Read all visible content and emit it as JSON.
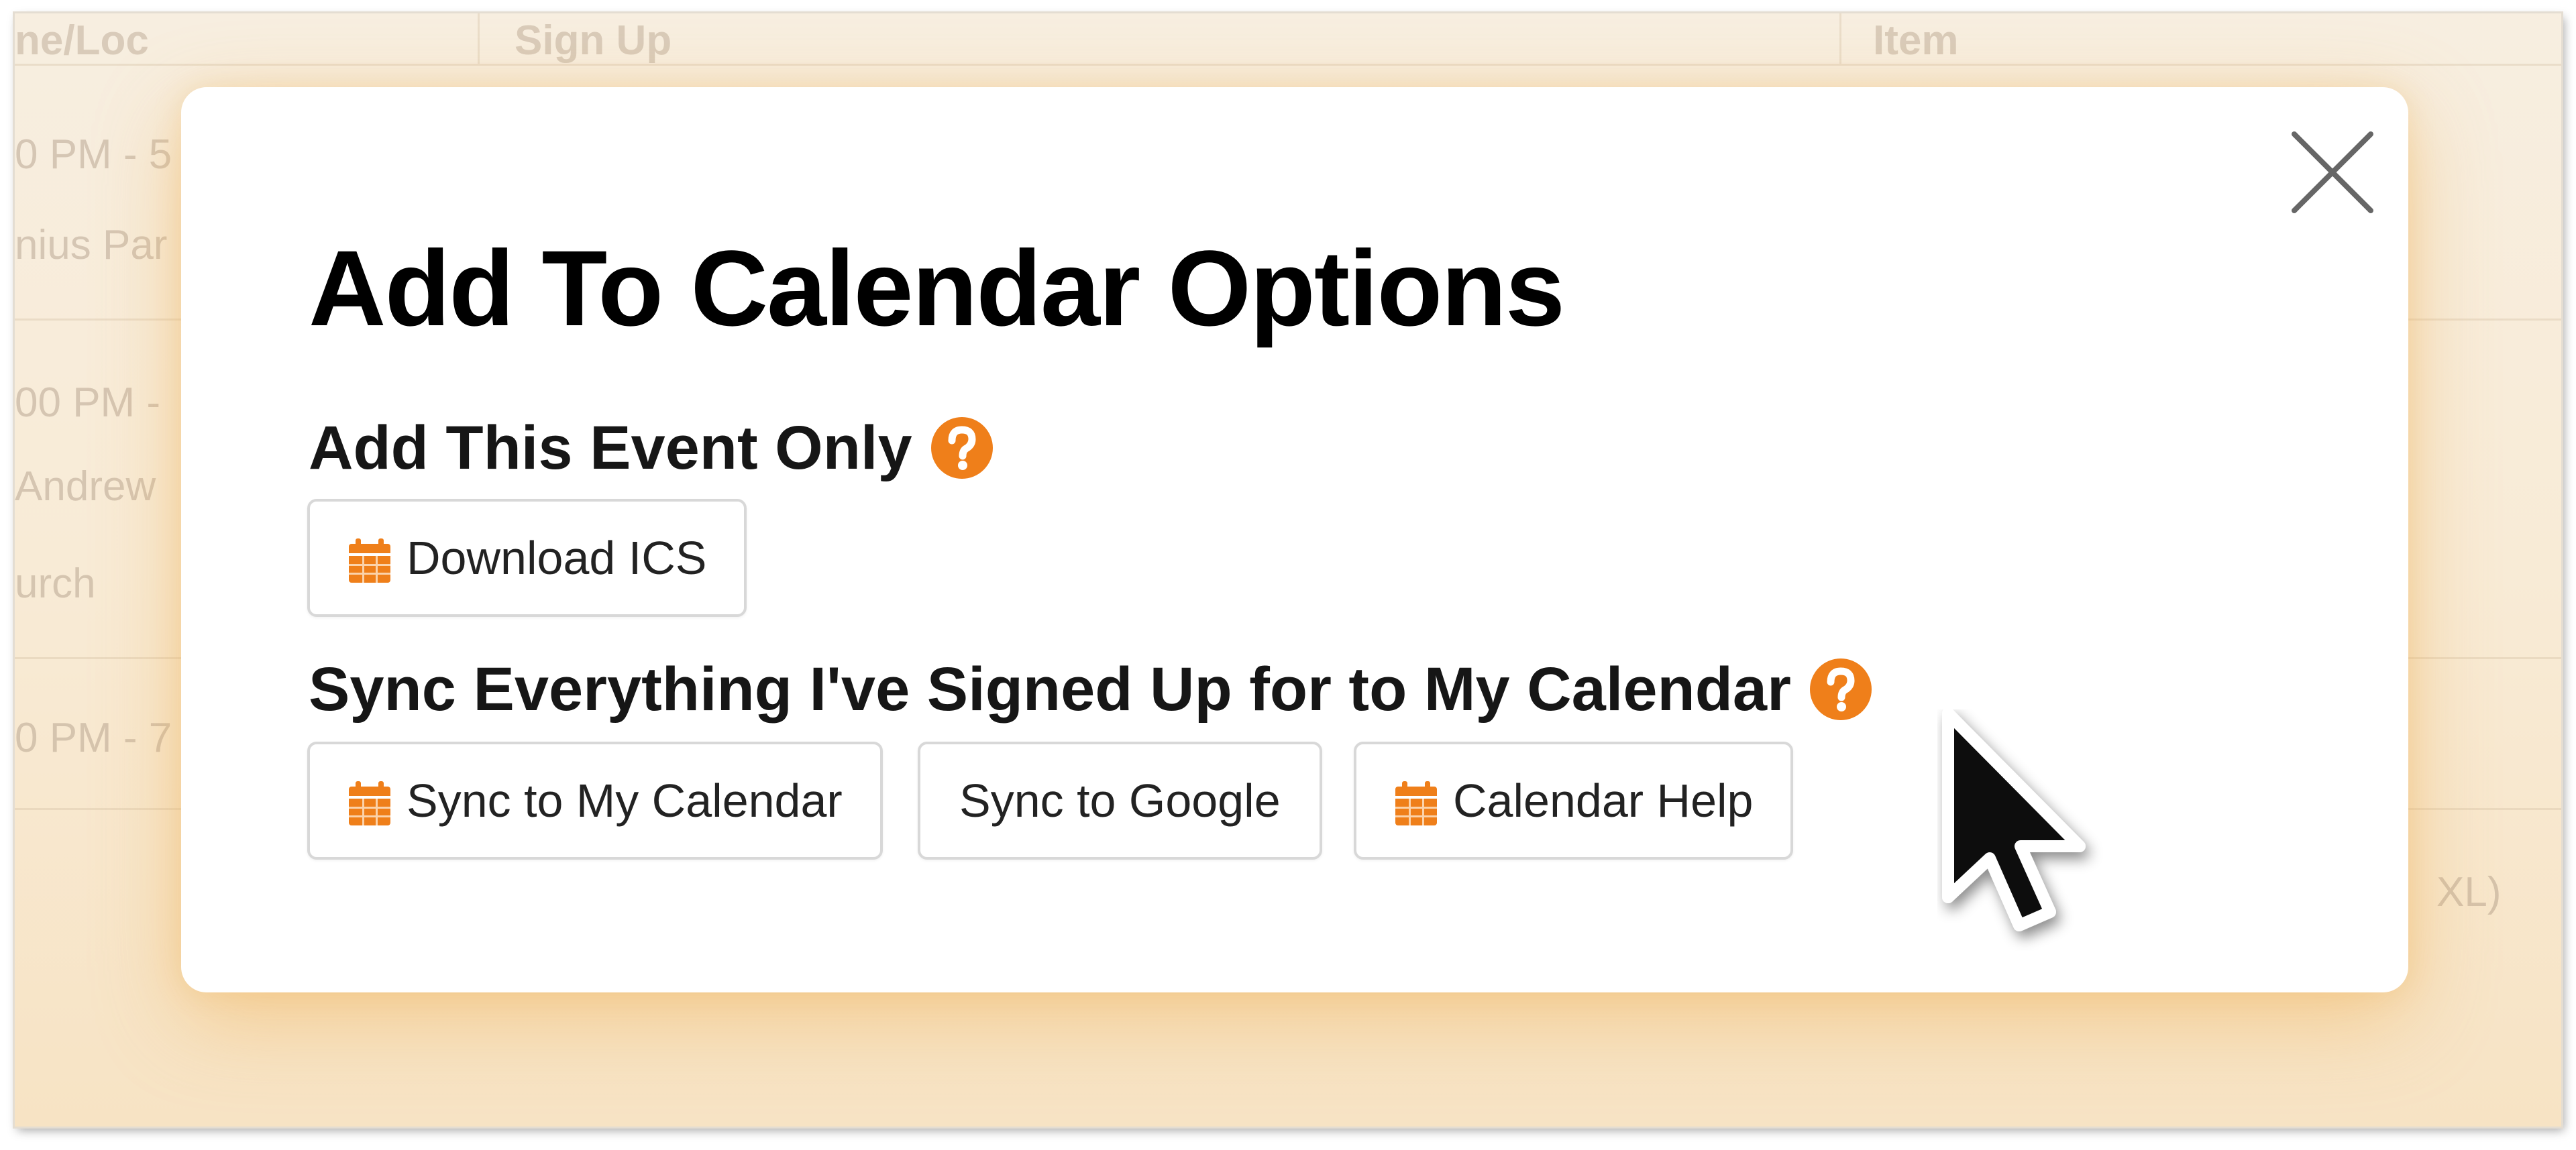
{
  "background_table": {
    "headers": [
      "ne/Loc",
      "Sign Up",
      "Item"
    ],
    "cells": [
      "0 PM - 5",
      "nius Par",
      "00 PM -",
      "Andrew",
      "urch",
      "0 PM - 7",
      "XL)"
    ]
  },
  "modal": {
    "title": "Add To Calendar Options",
    "section_event": {
      "heading": "Add This Event Only",
      "buttons": [
        {
          "label": "Download ICS",
          "icon": "calendar-icon"
        }
      ]
    },
    "section_sync": {
      "heading": "Sync Everything I've Signed Up for to My Calendar",
      "buttons": [
        {
          "label": "Sync to My Calendar",
          "icon": "calendar-icon"
        },
        {
          "label": "Sync to Google",
          "icon": ""
        },
        {
          "label": "Calendar Help",
          "icon": "calendar-icon"
        }
      ]
    },
    "close_icon": "close-icon",
    "help_icon": "question-mark-icon"
  },
  "colors": {
    "accent": "#ef7f1a",
    "backdrop": "#f8ebd6",
    "button_border": "#d8d8d8"
  }
}
